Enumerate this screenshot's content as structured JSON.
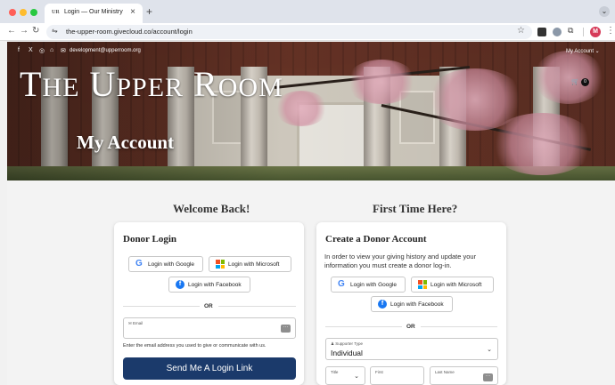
{
  "browser": {
    "tab_title": "Login — Our Ministry",
    "tab_favicon": "UR",
    "url": "the-upper-room.givecloud.co/account/login",
    "profile_initial": "M"
  },
  "site": {
    "top_email": "development@upperroom.org",
    "account_menu": "My Account",
    "cart_count": "0",
    "logo": {
      "big1": "T",
      "small1": "HE",
      "big2": "U",
      "small2": "PPER",
      "big3": "R",
      "small3": "OOM"
    },
    "hero_title": "My Account"
  },
  "login": {
    "heading": "Welcome Back!",
    "card_title": "Donor Login",
    "google": "Login with Google",
    "microsoft": "Login with Microsoft",
    "facebook": "Login with Facebook",
    "or": "OR",
    "email_label": "Email",
    "help_text": "Enter the email address you used to give or communicate with us.",
    "submit": "Send Me A Login Link"
  },
  "register": {
    "heading": "First Time Here?",
    "card_title": "Create a Donor Account",
    "description": "In order to view your giving history and update your information you must create a donor log-in.",
    "google": "Login with Google",
    "microsoft": "Login with Microsoft",
    "facebook": "Login with Facebook",
    "or": "OR",
    "supporter_type_label": "Supporter Type",
    "supporter_type_value": "Individual",
    "title_label": "Title",
    "first_label": "First",
    "last_label": "Last Name"
  },
  "colors": {
    "cta": "#1b3a6b",
    "facebook": "#1877f2",
    "google_blue": "#4285f4"
  }
}
